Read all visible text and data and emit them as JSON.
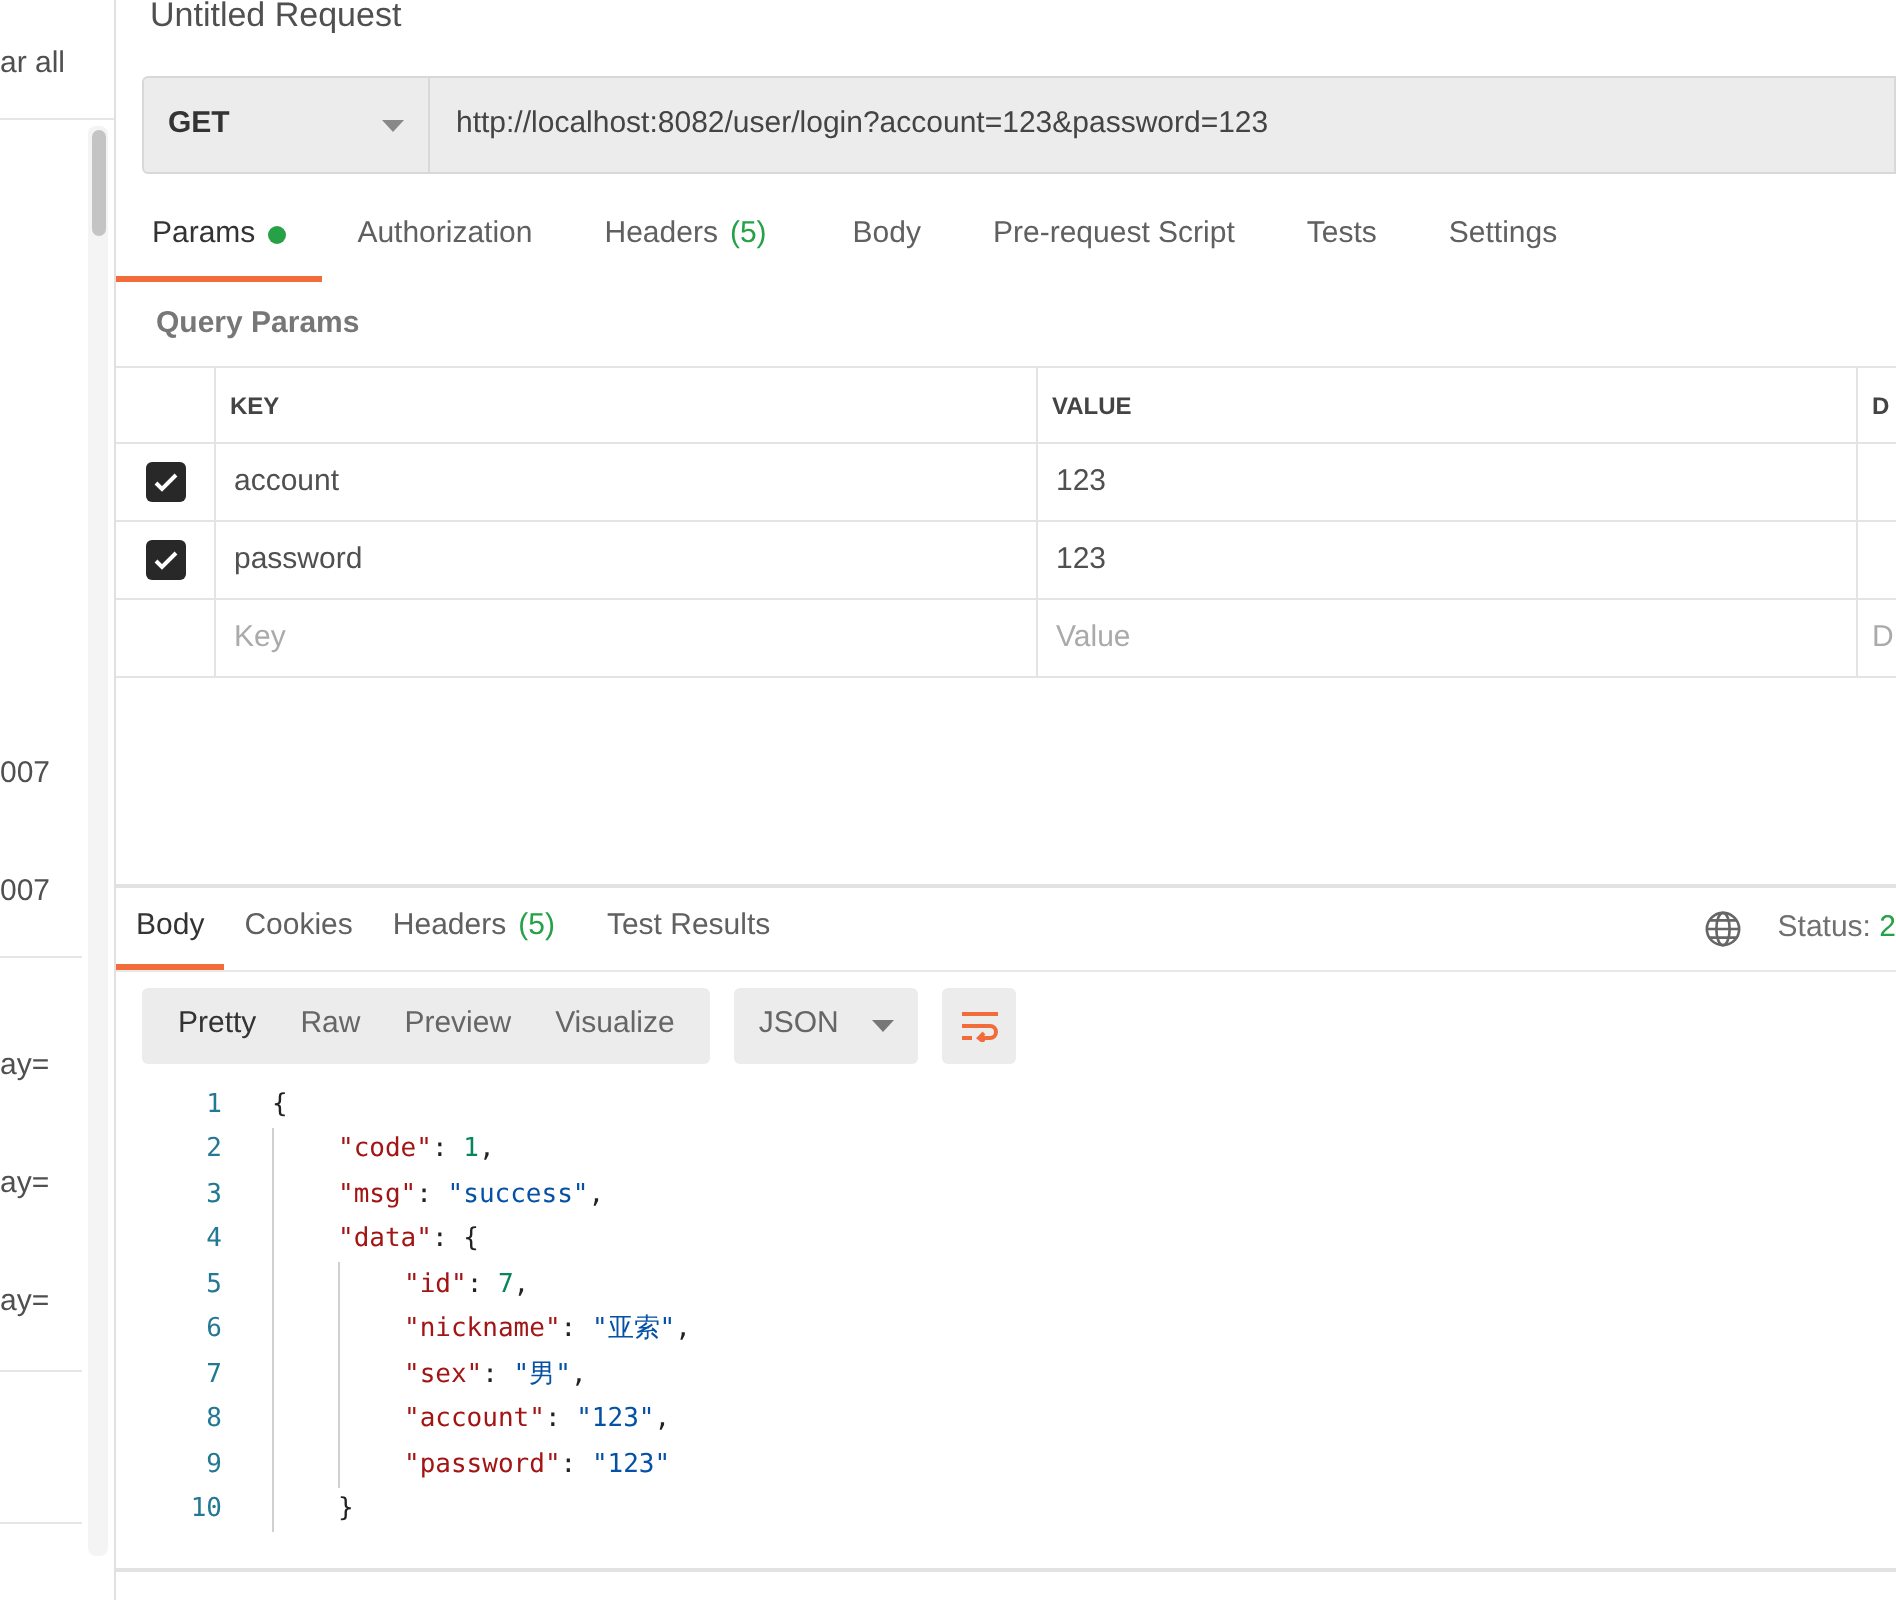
{
  "sidebar": {
    "clear_all": "ar all",
    "items": [
      {
        "text": "007"
      },
      {
        "text": "007"
      },
      {
        "text": "ay="
      },
      {
        "text": "ay="
      },
      {
        "text": "ay="
      }
    ]
  },
  "request": {
    "title": "Untitled Request",
    "method": "GET",
    "url": "http://localhost:8082/user/login?account=123&password=123"
  },
  "request_tabs": [
    {
      "label": "Params",
      "selected": true,
      "dot": true
    },
    {
      "label": "Authorization",
      "selected": false
    },
    {
      "label": "Headers",
      "count": "(5)",
      "selected": false
    },
    {
      "label": "Body",
      "selected": false
    },
    {
      "label": "Pre-request Script",
      "selected": false
    },
    {
      "label": "Tests",
      "selected": false
    },
    {
      "label": "Settings",
      "selected": false
    }
  ],
  "query_params": {
    "title": "Query Params",
    "columns": [
      "KEY",
      "VALUE",
      "D"
    ],
    "rows": [
      {
        "checked": true,
        "key": "account",
        "value": "123"
      },
      {
        "checked": true,
        "key": "password",
        "value": "123"
      }
    ],
    "placeholders": {
      "key": "Key",
      "value": "Value",
      "description": "D"
    }
  },
  "response_tabs": [
    {
      "label": "Body",
      "selected": true
    },
    {
      "label": "Cookies",
      "selected": false
    },
    {
      "label": "Headers",
      "count": "(5)",
      "selected": false
    },
    {
      "label": "Test Results",
      "selected": false
    }
  ],
  "status": {
    "label": "Status:",
    "value": "2"
  },
  "view_modes": [
    {
      "label": "Pretty",
      "selected": true
    },
    {
      "label": "Raw",
      "selected": false
    },
    {
      "label": "Preview",
      "selected": false
    },
    {
      "label": "Visualize",
      "selected": false
    }
  ],
  "format": "JSON",
  "code_lines": [
    {
      "number": "1",
      "tokens": [
        {
          "kind": "punct",
          "text": "{"
        }
      ],
      "children": [
        {
          "number": "2",
          "tokens": [
            {
              "kind": "key",
              "text": "\"code\""
            },
            {
              "kind": "punct",
              "text": ": "
            },
            {
              "kind": "number",
              "text": "1"
            },
            {
              "kind": "punct",
              "text": ","
            }
          ]
        },
        {
          "number": "3",
          "tokens": [
            {
              "kind": "key",
              "text": "\"msg\""
            },
            {
              "kind": "punct",
              "text": ": "
            },
            {
              "kind": "string",
              "text": "\"success\""
            },
            {
              "kind": "punct",
              "text": ","
            }
          ]
        },
        {
          "number": "4",
          "tokens": [
            {
              "kind": "key",
              "text": "\"data\""
            },
            {
              "kind": "punct",
              "text": ": {"
            }
          ],
          "children": [
            {
              "number": "5",
              "tokens": [
                {
                  "kind": "key",
                  "text": "\"id\""
                },
                {
                  "kind": "punct",
                  "text": ": "
                },
                {
                  "kind": "number",
                  "text": "7"
                },
                {
                  "kind": "punct",
                  "text": ","
                }
              ]
            },
            {
              "number": "6",
              "tokens": [
                {
                  "kind": "key",
                  "text": "\"nickname\""
                },
                {
                  "kind": "punct",
                  "text": ": "
                },
                {
                  "kind": "string",
                  "text": "\"亚索\""
                },
                {
                  "kind": "punct",
                  "text": ","
                }
              ]
            },
            {
              "number": "7",
              "tokens": [
                {
                  "kind": "key",
                  "text": "\"sex\""
                },
                {
                  "kind": "punct",
                  "text": ": "
                },
                {
                  "kind": "string",
                  "text": "\"男\""
                },
                {
                  "kind": "punct",
                  "text": ","
                }
              ]
            },
            {
              "number": "8",
              "tokens": [
                {
                  "kind": "key",
                  "text": "\"account\""
                },
                {
                  "kind": "punct",
                  "text": ": "
                },
                {
                  "kind": "string",
                  "text": "\"123\""
                },
                {
                  "kind": "punct",
                  "text": ","
                }
              ]
            },
            {
              "number": "9",
              "tokens": [
                {
                  "kind": "key",
                  "text": "\"password\""
                },
                {
                  "kind": "punct",
                  "text": ": "
                },
                {
                  "kind": "string",
                  "text": "\"123\""
                }
              ]
            }
          ]
        },
        {
          "number": "10",
          "tokens": [
            {
              "kind": "punct",
              "text": "}"
            }
          ]
        }
      ]
    }
  ]
}
